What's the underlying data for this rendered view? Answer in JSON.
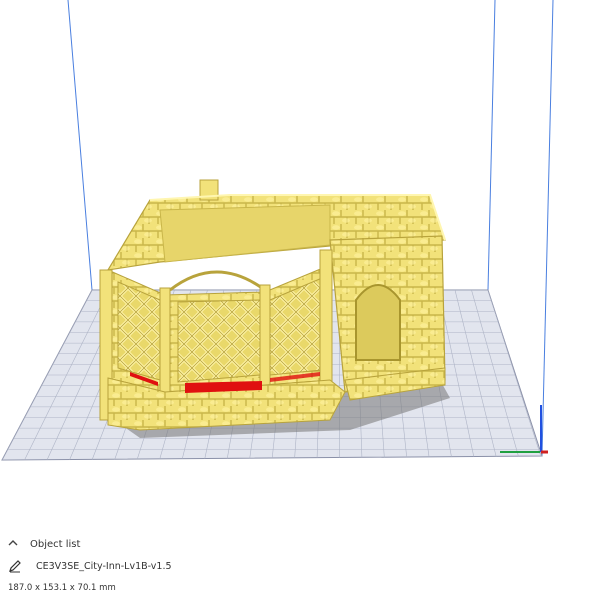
{
  "viewport": {
    "model_color": "#f2e27a",
    "model_shadow": "#c9b64a",
    "overhang_color": "#e01010",
    "bed_color": "#e2e5ee",
    "grid_color": "#aeb4c6",
    "build_volume_line_color": "#4a7fe0",
    "axis_colors": {
      "x": "#d02020",
      "y": "#20a040",
      "z": "#2050e0"
    }
  },
  "object_list": {
    "header_label": "Object list",
    "header_icon": "chevron-up-icon",
    "item": {
      "icon": "pencil-icon",
      "name": "CE3V3SE_City-Inn-Lv1B-v1.5"
    },
    "dimensions": "187.0 x 153.1 x 70.1 mm"
  }
}
